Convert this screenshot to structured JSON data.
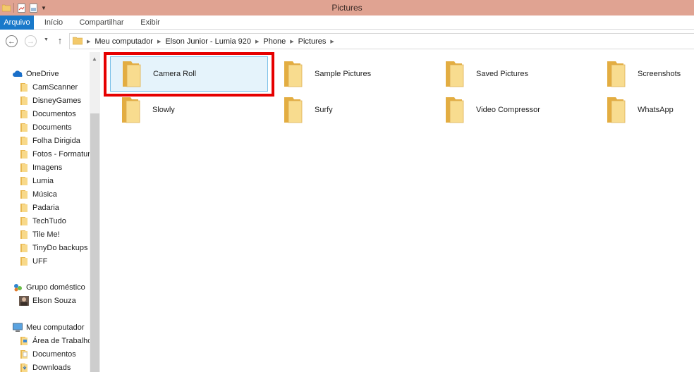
{
  "window": {
    "title": "Pictures"
  },
  "ribbon": {
    "tabs": [
      "Arquivo",
      "Início",
      "Compartilhar",
      "Exibir"
    ]
  },
  "address": {
    "crumbs": [
      "Meu computador",
      "Elson Junior - Lumia 920",
      "Phone",
      "Pictures"
    ]
  },
  "nav": {
    "onedrive": {
      "label": "OneDrive",
      "items": [
        "CamScanner",
        "DisneyGames",
        "Documentos",
        "Documents",
        "Folha Dirigida",
        "Fotos - Formatur",
        "Imagens",
        "Lumia",
        "Música",
        "Padaria",
        "TechTudo",
        "Tile Me!",
        "TinyDo backups",
        "UFF"
      ]
    },
    "homegroup": {
      "label": "Grupo doméstico",
      "items": [
        "Elson Souza"
      ]
    },
    "computer": {
      "label": "Meu computador",
      "items": [
        "Área de Trabalho",
        "Documentos",
        "Downloads"
      ]
    }
  },
  "content": {
    "folders": [
      "Camera Roll",
      "Sample Pictures",
      "Saved Pictures",
      "Screenshots",
      "Slowly",
      "Surfy",
      "Video Compressor",
      "WhatsApp"
    ],
    "selected": "Camera Roll"
  },
  "colors": {
    "titlebar": "#e0a392",
    "file_tab": "#1979ca",
    "folder": "#f3c96b",
    "highlight": "#e60000",
    "selection": "#e5f3fb"
  },
  "icons": {
    "back": "arrow-left-icon",
    "forward": "arrow-right-icon",
    "up": "arrow-up-icon",
    "folder": "folder-icon",
    "onedrive": "cloud-icon",
    "homegroup": "homegroup-icon",
    "computer": "computer-icon"
  }
}
